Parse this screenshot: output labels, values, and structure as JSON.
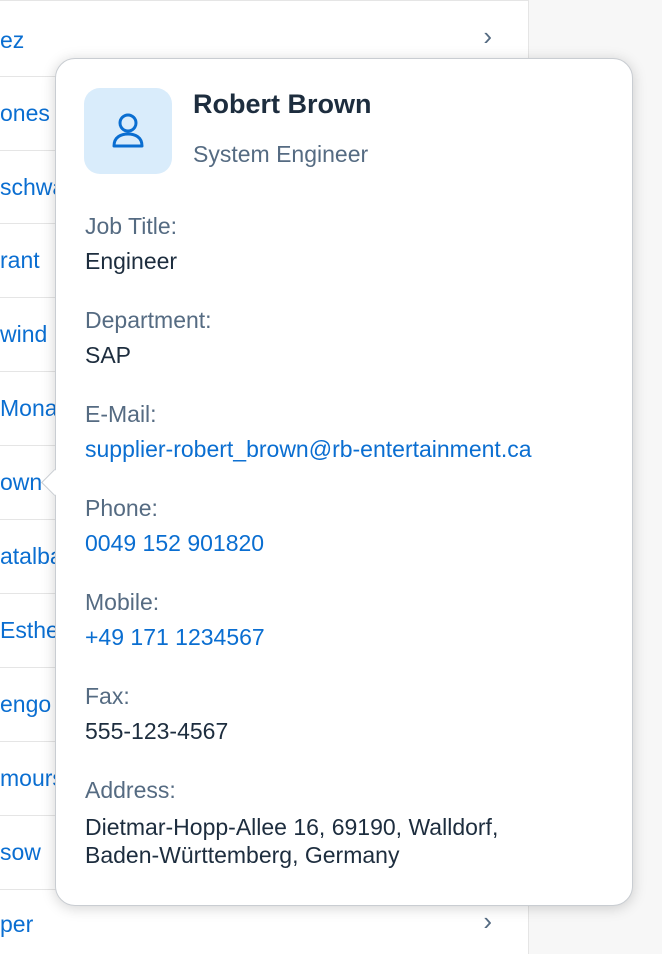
{
  "list": {
    "rows": [
      {
        "text": "ez",
        "chevron": true
      },
      {
        "text": "ones",
        "chevron": false
      },
      {
        "text": "schwa",
        "chevron": false
      },
      {
        "text": "rant",
        "chevron": false
      },
      {
        "text": "wind",
        "chevron": false
      },
      {
        "text": "Monat",
        "chevron": false
      },
      {
        "text": "own",
        "chevron": false
      },
      {
        "text": "atalba",
        "chevron": false
      },
      {
        "text": "Esther",
        "chevron": false
      },
      {
        "text": "engo",
        "chevron": false
      },
      {
        "text": "mours",
        "chevron": false
      },
      {
        "text": "sow",
        "chevron": false
      },
      {
        "text": "per",
        "chevron": true
      }
    ],
    "chevron_glyph": "›"
  },
  "popover": {
    "avatar_icon": "person-icon",
    "name": "Robert Brown",
    "role": "System Engineer",
    "fields": {
      "job_title": {
        "label": "Job Title:",
        "value": "Engineer"
      },
      "department": {
        "label": "Department:",
        "value": "SAP"
      },
      "email": {
        "label": "E-Mail:",
        "value": "supplier-robert_brown@rb-entertainment.ca"
      },
      "phone": {
        "label": "Phone:",
        "value": "0049 152 901820"
      },
      "mobile": {
        "label": "Mobile:",
        "value": "+49 171 1234567"
      },
      "fax": {
        "label": "Fax:",
        "value": "555-123-4567"
      },
      "address": {
        "label": "Address:",
        "line1": "Dietmar-Hopp-Allee 16, 69190, Walldorf,",
        "line2": "Baden-Württemberg, Germany"
      }
    }
  },
  "colors": {
    "link": "#0a6ed1",
    "label": "#556b82",
    "text": "#1d2d3e",
    "avatar_bg": "#d9ecfb"
  }
}
